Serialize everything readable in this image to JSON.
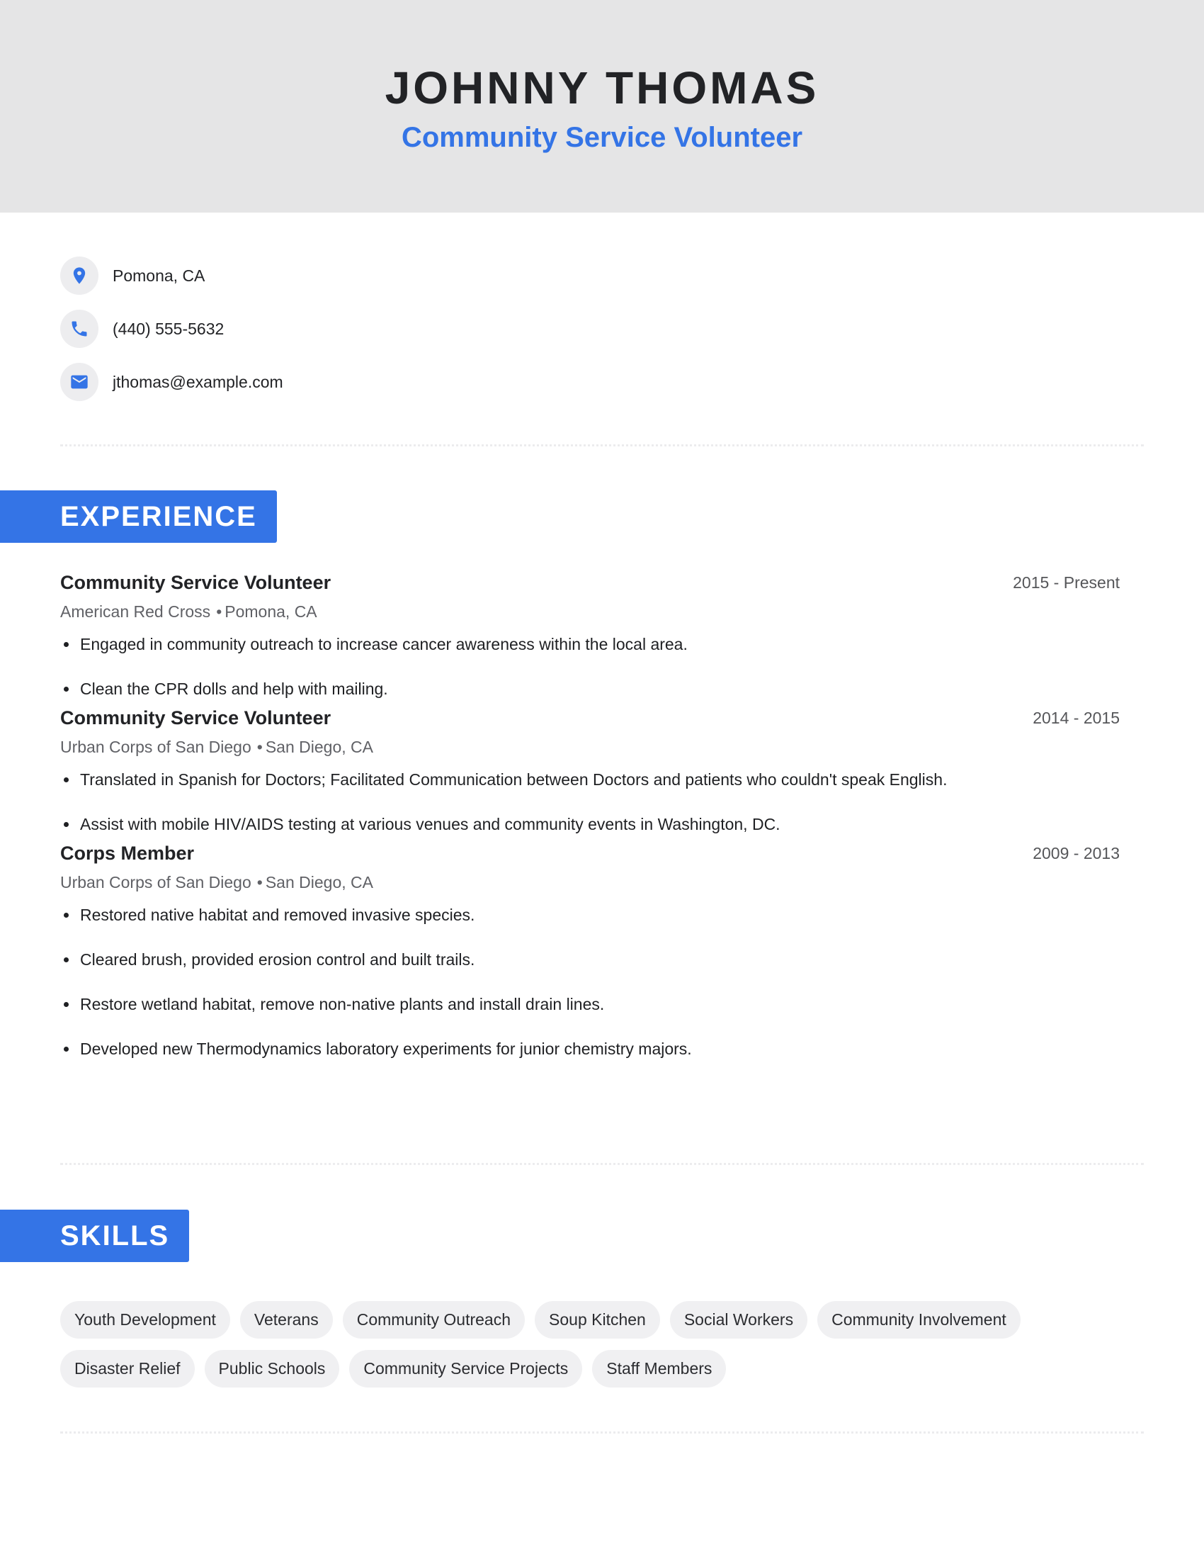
{
  "header": {
    "name": "JOHNNY THOMAS",
    "role": "Community Service Volunteer"
  },
  "contact": [
    {
      "icon": "location-pin-icon",
      "text": "Pomona, CA"
    },
    {
      "icon": "phone-icon",
      "text": "(440) 555-5632"
    },
    {
      "icon": "email-icon",
      "text": "jthomas@example.com"
    }
  ],
  "sections": {
    "experience": "EXPERIENCE",
    "skills": "SKILLS"
  },
  "experience": [
    {
      "title": "Community Service Volunteer",
      "date": "2015 - Present",
      "org": "American Red Cross",
      "location": "Pomona, CA",
      "bullets": [
        "Engaged in community outreach to increase cancer awareness within the local area.",
        "Clean the CPR dolls and help with mailing."
      ]
    },
    {
      "title": "Community Service Volunteer",
      "date": "2014 - 2015",
      "org": "Urban Corps of San Diego",
      "location": "San Diego, CA",
      "bullets": [
        "Translated in Spanish for Doctors; Facilitated Communication between Doctors and patients who couldn't speak English.",
        "Assist with mobile HIV/AIDS testing at various venues and community events in Washington, DC."
      ]
    },
    {
      "title": "Corps Member",
      "date": "2009 - 2013",
      "org": "Urban Corps of San Diego",
      "location": "San Diego, CA",
      "bullets": [
        "Restored native habitat and removed invasive species.",
        "Cleared brush, provided erosion control and built trails.",
        "Restore wetland habitat, remove non-native plants and install drain lines.",
        "Developed new Thermodynamics laboratory experiments for junior chemistry majors."
      ]
    }
  ],
  "separator": "•",
  "skills": [
    "Youth Development",
    "Veterans",
    "Community Outreach",
    "Soup Kitchen",
    "Social Workers",
    "Community Involvement",
    "Disaster Relief",
    "Public Schools",
    "Community Service Projects",
    "Staff Members"
  ],
  "colors": {
    "accent": "#3474e6",
    "header_bg": "#e5e5e6",
    "chip_bg": "#f0f0f2"
  }
}
